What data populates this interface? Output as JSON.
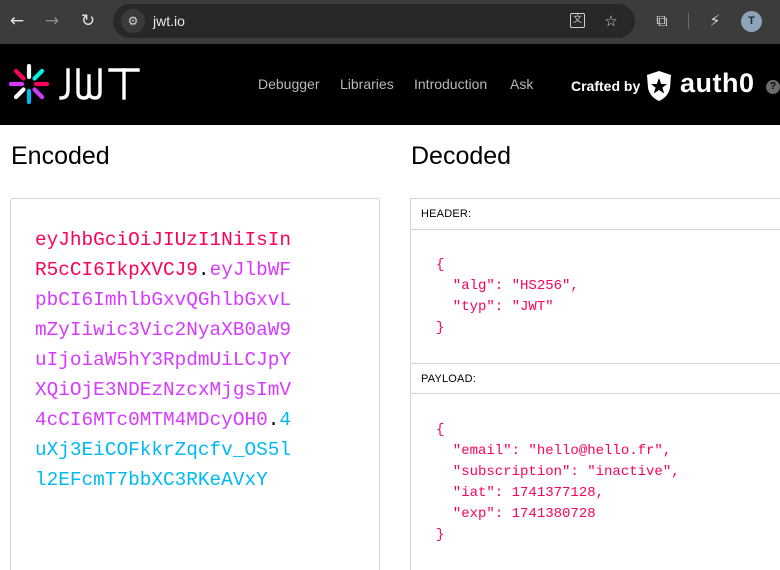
{
  "browser": {
    "url": "jwt.io",
    "avatar_letter": "T"
  },
  "site": {
    "logo_text": "JWT",
    "nav": [
      "Debugger",
      "Libraries",
      "Introduction",
      "Ask"
    ],
    "crafted_by": "Crafted by",
    "brand": "auth0"
  },
  "encoded": {
    "title": "Encoded",
    "lines": [
      [
        {
          "part": "header",
          "text": "eyJhbGciOiJIUzI1NiIsIn"
        }
      ],
      [
        {
          "part": "header",
          "text": "R5cCI6IkpXVCJ9"
        },
        {
          "part": "dot",
          "text": "."
        },
        {
          "part": "payload",
          "text": "eyJlbWF"
        }
      ],
      [
        {
          "part": "payload",
          "text": "pbCI6ImhlbGxvQGhlbGxvL"
        }
      ],
      [
        {
          "part": "payload",
          "text": "mZyIiwic3Vic2NyaXB0aW9"
        }
      ],
      [
        {
          "part": "payload",
          "text": "uIjoiaW5hY3RpdmUiLCJpY"
        }
      ],
      [
        {
          "part": "payload",
          "text": "XQiOjE3NDEzNzcxMjgsImV"
        }
      ],
      [
        {
          "part": "payload",
          "text": "4cCI6MTc0MTM4MDcyOH0"
        },
        {
          "part": "dot",
          "text": "."
        },
        {
          "part": "signature",
          "text": "4"
        }
      ],
      [
        {
          "part": "signature",
          "text": "uXj3EiCOFkkrZqcfv_OS5l"
        }
      ],
      [
        {
          "part": "signature",
          "text": "l2EFcmT7bbXC3RKeAVxY"
        }
      ]
    ]
  },
  "decoded": {
    "title": "Decoded",
    "header_label": "HEADER:",
    "payload_label": "PAYLOAD:",
    "header_lines": [
      "{",
      "  \"alg\": \"HS256\",",
      "  \"typ\": \"JWT\"",
      "}"
    ],
    "payload_lines": [
      "{",
      "  \"email\": \"hello@hello.fr\",",
      "  \"subscription\": \"inactive\",",
      "  \"iat\": 1741377128,",
      "  \"exp\": 1741380728",
      "}"
    ]
  },
  "colors": {
    "header": "#fb015b",
    "payload": "#d63aff",
    "signature": "#00b9f1"
  }
}
